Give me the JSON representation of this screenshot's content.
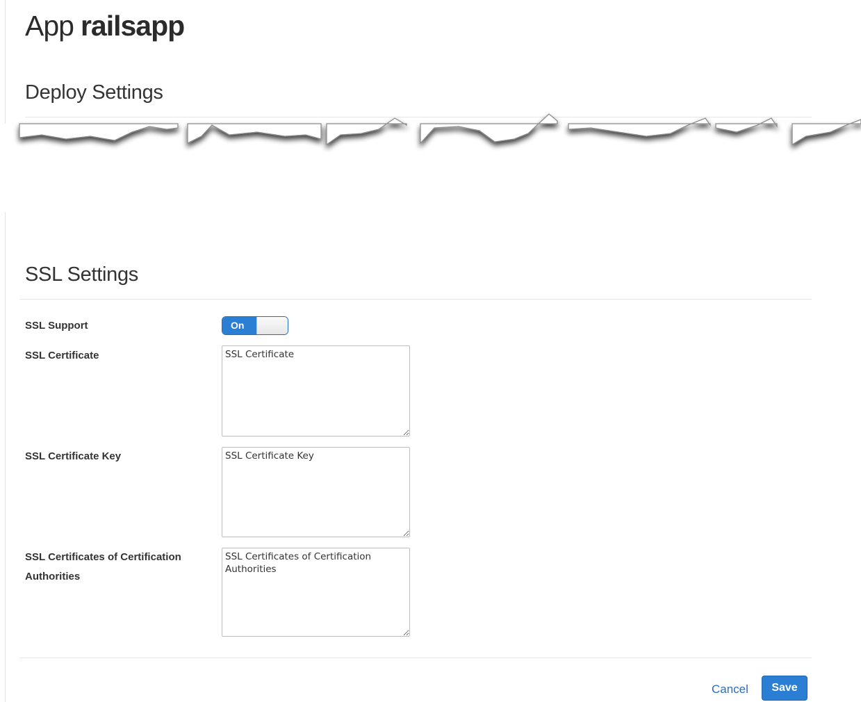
{
  "header": {
    "prefix": "App",
    "app_name": "railsapp"
  },
  "deploy_section": {
    "title": "Deploy Settings"
  },
  "ssl_section": {
    "title": "SSL Settings",
    "ssl_support": {
      "label": "SSL Support",
      "toggle_label": "On",
      "enabled": true
    },
    "certificate": {
      "label": "SSL Certificate",
      "placeholder": "SSL Certificate"
    },
    "certificate_key": {
      "label": "SSL Certificate Key",
      "placeholder": "SSL Certificate Key"
    },
    "ca_certificates": {
      "label": "SSL Certificates of Certification Authorities",
      "placeholder": "SSL Certificates of Certification Authorities"
    }
  },
  "footer": {
    "cancel_label": "Cancel",
    "save_label": "Save"
  },
  "colors": {
    "accent": "#2a7ed4",
    "link": "#2a6cbf",
    "border": "#bdbdbd"
  }
}
